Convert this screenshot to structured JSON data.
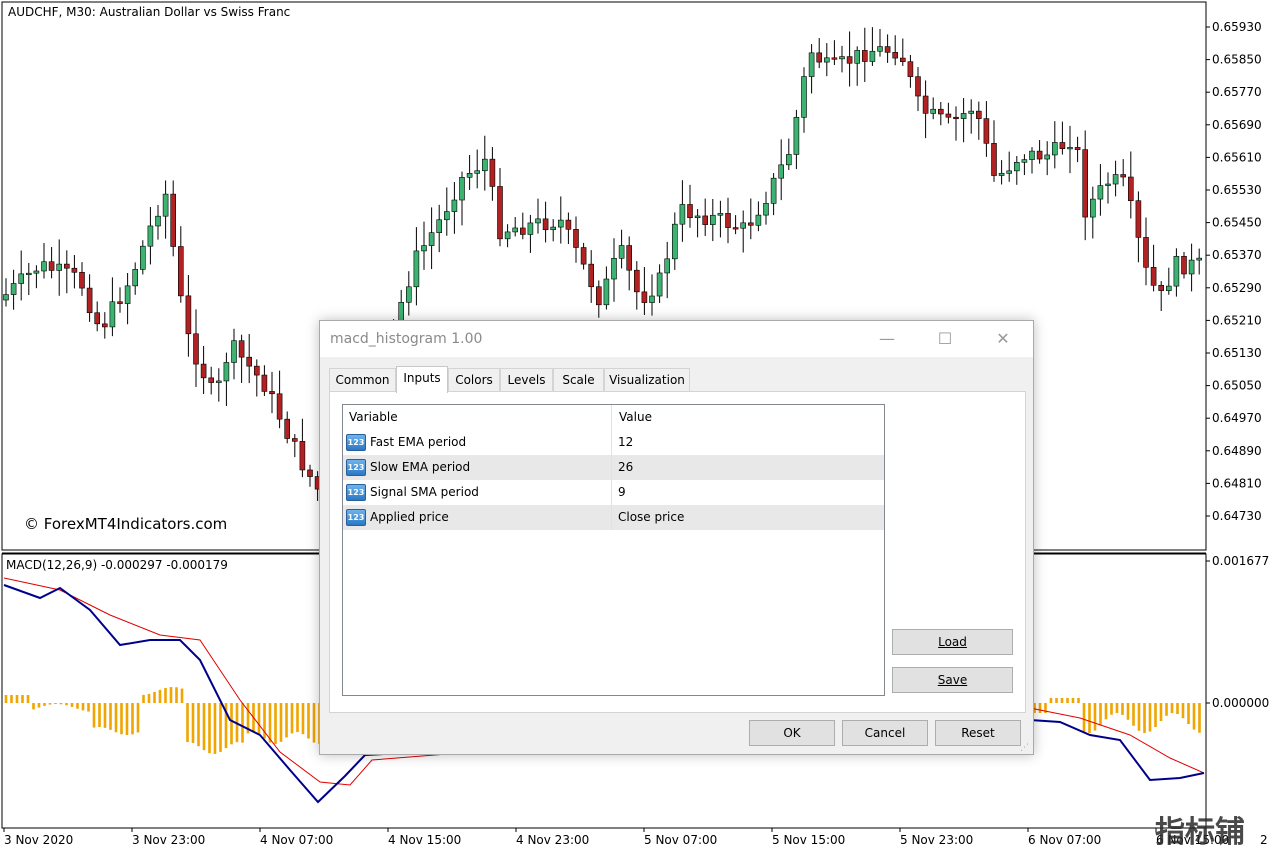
{
  "chart": {
    "symbol_title": "AUDCHF, M30:  Australian Dollar vs Swiss Franc",
    "watermark": "© ForexMT4Indicators.com",
    "indicator_title": "MACD(12,26,9) -0.000297 -0.000179",
    "price_ticks": [
      "0.65930",
      "0.65850",
      "0.65770",
      "0.65690",
      "0.65610",
      "0.65530",
      "0.65450",
      "0.65370",
      "0.65290",
      "0.65210",
      "0.65130",
      "0.65050",
      "0.64970",
      "0.64890",
      "0.64810",
      "0.64730"
    ],
    "macd_ticks": [
      "0.001677",
      "0.000000"
    ],
    "time_ticks": [
      "3 Nov 2020",
      "3 Nov 23:00",
      "4 Nov 07:00",
      "4 Nov 15:00",
      "4 Nov 23:00",
      "5 Nov 07:00",
      "5 Nov 15:00",
      "5 Nov 23:00",
      "6 Nov 07:00",
      "6 Nov 15:00"
    ],
    "time_ticks_tail": "2",
    "corner_logo": "指标铺",
    "colors": {
      "bull": "#3cb371",
      "bear": "#b22222",
      "histogram": "#f0a500",
      "macd_line": "#00008b",
      "signal_line": "#e00000"
    }
  },
  "dialog": {
    "title": "macd_histogram 1.00",
    "tabs": [
      "Common",
      "Inputs",
      "Colors",
      "Levels",
      "Scale",
      "Visualization"
    ],
    "active_tab": "Inputs",
    "columns": [
      "Variable",
      "Value"
    ],
    "rows": [
      {
        "icon": "123",
        "variable": "Fast EMA period",
        "value": "12"
      },
      {
        "icon": "123",
        "variable": "Slow EMA period",
        "value": "26"
      },
      {
        "icon": "123",
        "variable": "Signal SMA period",
        "value": "9"
      },
      {
        "icon": "123",
        "variable": "Applied price",
        "value": "Close price"
      }
    ],
    "buttons": {
      "load": "Load",
      "save": "Save",
      "ok": "OK",
      "cancel": "Cancel",
      "reset": "Reset"
    }
  }
}
